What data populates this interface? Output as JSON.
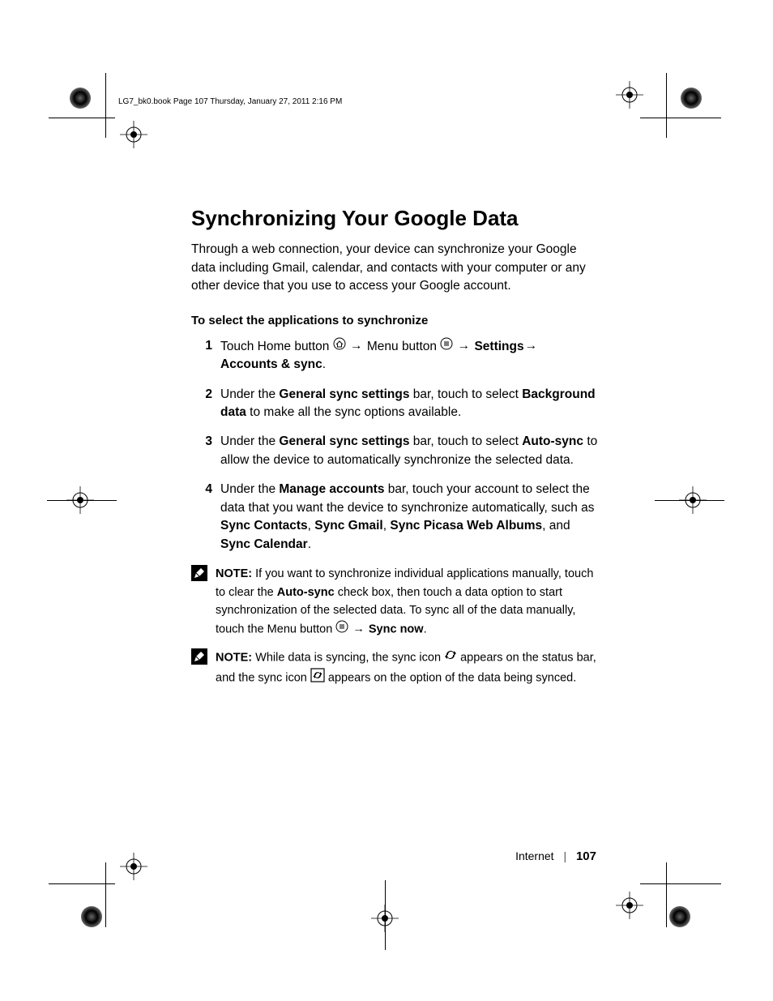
{
  "header_line": "LG7_bk0.book  Page 107  Thursday, January 27, 2011  2:16 PM",
  "title": "Synchronizing Your Google Data",
  "intro": "Through a web connection, your device can synchronize your Google data including Gmail, calendar, and contacts with your computer or any other device that you use to access your Google account.",
  "subhead": "To select the applications to synchronize",
  "arrow": "→",
  "steps": {
    "s1": {
      "num": "1",
      "a": "Touch Home button ",
      "b": " Menu button ",
      "c": "Settings",
      "d": "Accounts & sync",
      "period": "."
    },
    "s2": {
      "num": "2",
      "a": "Under the ",
      "b": "General sync settings",
      "c": " bar, touch to select ",
      "d": "Background data",
      "e": " to make all the sync options available."
    },
    "s3": {
      "num": "3",
      "a": "Under the ",
      "b": "General sync settings",
      "c": " bar, touch to select ",
      "d": "Auto-sync",
      "e": " to allow the device to automatically synchronize the selected data."
    },
    "s4": {
      "num": "4",
      "a": "Under the ",
      "b": "Manage accounts",
      "c": " bar, touch your account to select the data that you want the device to synchronize automatically, such as ",
      "d": "Sync Contacts",
      "e": ", ",
      "f": "Sync Gmail",
      "g": ", ",
      "h": "Sync Picasa Web Albums",
      "i": ", and ",
      "j": "Sync Calendar",
      "k": "."
    }
  },
  "note1": {
    "label": "NOTE:",
    "a": " If you want to synchronize individual applications manually, touch to clear the ",
    "b": "Auto-sync",
    "c": " check box, then touch a data option to start synchronization of the selected data. To sync all of the data manually, touch the Menu button ",
    "d": "Sync now",
    "e": "."
  },
  "note2": {
    "label": "NOTE:",
    "a": " While data is syncing, the sync icon ",
    "b": " appears on the status bar, and the sync icon ",
    "c": " appears on the option of the data being synced."
  },
  "footer": {
    "section": "Internet",
    "page": "107"
  }
}
